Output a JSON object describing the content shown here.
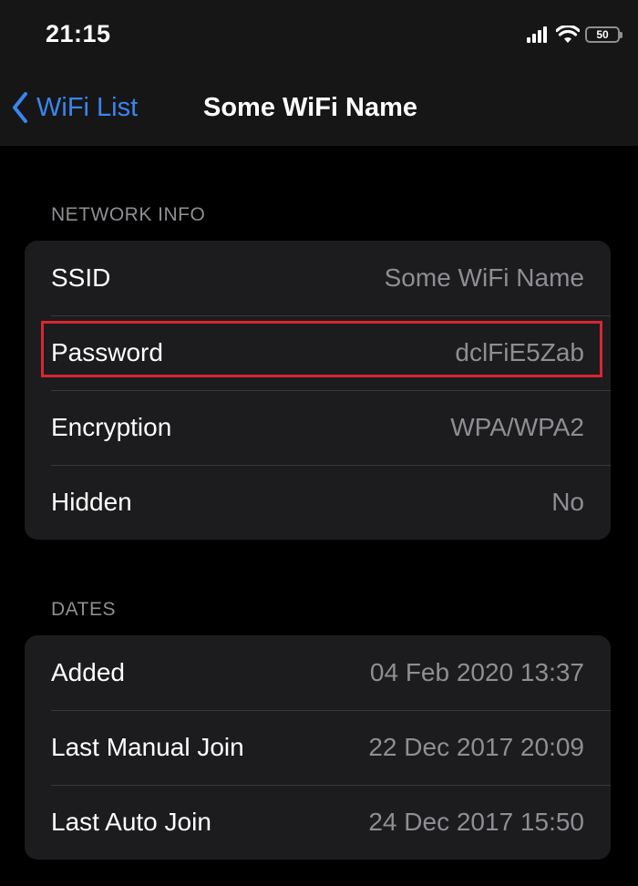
{
  "status_bar": {
    "time": "21:15",
    "battery": "50"
  },
  "nav": {
    "back_label": "WiFi List",
    "title": "Some WiFi Name"
  },
  "sections": {
    "network_info": {
      "header": "NETWORK INFO",
      "rows": [
        {
          "label": "SSID",
          "value": "Some WiFi Name"
        },
        {
          "label": "Password",
          "value": "dclFiE5Zab"
        },
        {
          "label": "Encryption",
          "value": "WPA/WPA2"
        },
        {
          "label": "Hidden",
          "value": "No"
        }
      ]
    },
    "dates": {
      "header": "DATES",
      "rows": [
        {
          "label": "Added",
          "value": "04 Feb 2020 13:37"
        },
        {
          "label": "Last Manual Join",
          "value": "22 Dec 2017 20:09"
        },
        {
          "label": "Last Auto Join",
          "value": "24 Dec 2017 15:50"
        }
      ]
    }
  },
  "colors": {
    "accent": "#3a85f0",
    "highlight": "#d9262f",
    "background": "#000000",
    "cell": "#1c1c1e",
    "secondary_text": "#8e8e93"
  },
  "icons": {
    "back": "chevron-left-icon",
    "signal": "cellular-signal-icon",
    "wifi": "wifi-icon",
    "battery": "battery-icon"
  }
}
